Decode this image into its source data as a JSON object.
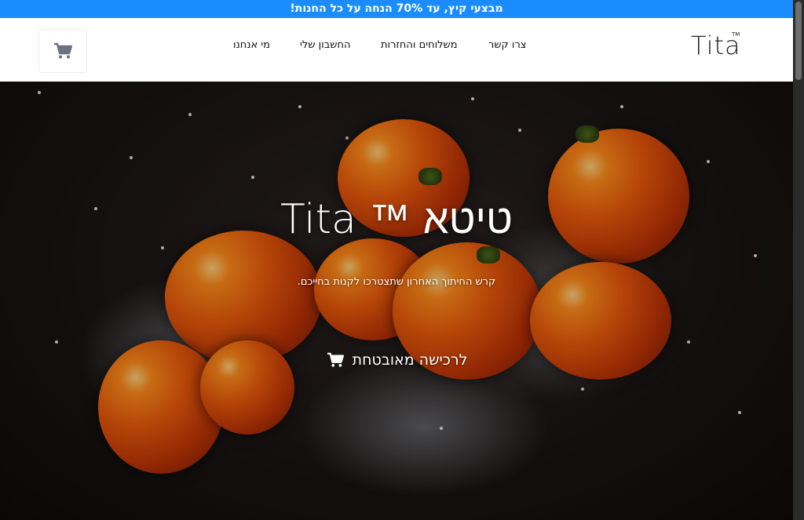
{
  "promo": {
    "text": "מבצעי קיץ, עד 70% הנחה על כל החנות!"
  },
  "header": {
    "logo_text": "Tita",
    "logo_tm": "TM",
    "nav": [
      "צרו קשר",
      "משלוחים והחזרות",
      "החשבון שלי",
      "מי אנחנו"
    ],
    "cart_icon": "cart-icon"
  },
  "hero": {
    "title": "טיטא ™ Tita",
    "subtitle": "קרש החיתוך האחרון שתצטרכו לקנות בחייכם.",
    "button_label": "לרכישה מאובטחת",
    "button_icon": "cart-icon"
  },
  "colors": {
    "promo_bar": "#1a8cff",
    "header_bg": "#ffffff",
    "text_light": "#ffffff"
  }
}
